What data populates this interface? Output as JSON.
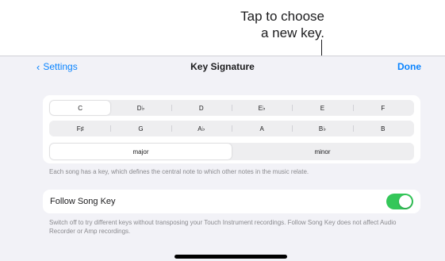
{
  "callout": {
    "line1": "Tap to choose",
    "line2": "a new key."
  },
  "nav": {
    "back_label": "Settings",
    "title": "Key Signature",
    "done_label": "Done"
  },
  "keys": {
    "row1": [
      "C",
      "D♭",
      "D",
      "E♭",
      "E",
      "F"
    ],
    "row2": [
      "F♯",
      "G",
      "A♭",
      "A",
      "B♭",
      "B"
    ],
    "selected": "C"
  },
  "mode": {
    "options": [
      "major",
      "minor"
    ],
    "selected": "major"
  },
  "key_footnote": "Each song has a key, which defines the central note to which other notes in the music relate.",
  "follow": {
    "label": "Follow Song Key",
    "enabled": true,
    "footnote": "Switch off to try different keys without transposing your Touch Instrument recordings. Follow Song Key does not affect Audio Recorder or Amp recordings."
  },
  "colors": {
    "accent": "#0a84ff",
    "toggle_on": "#34c759",
    "background": "#f2f2f7"
  }
}
